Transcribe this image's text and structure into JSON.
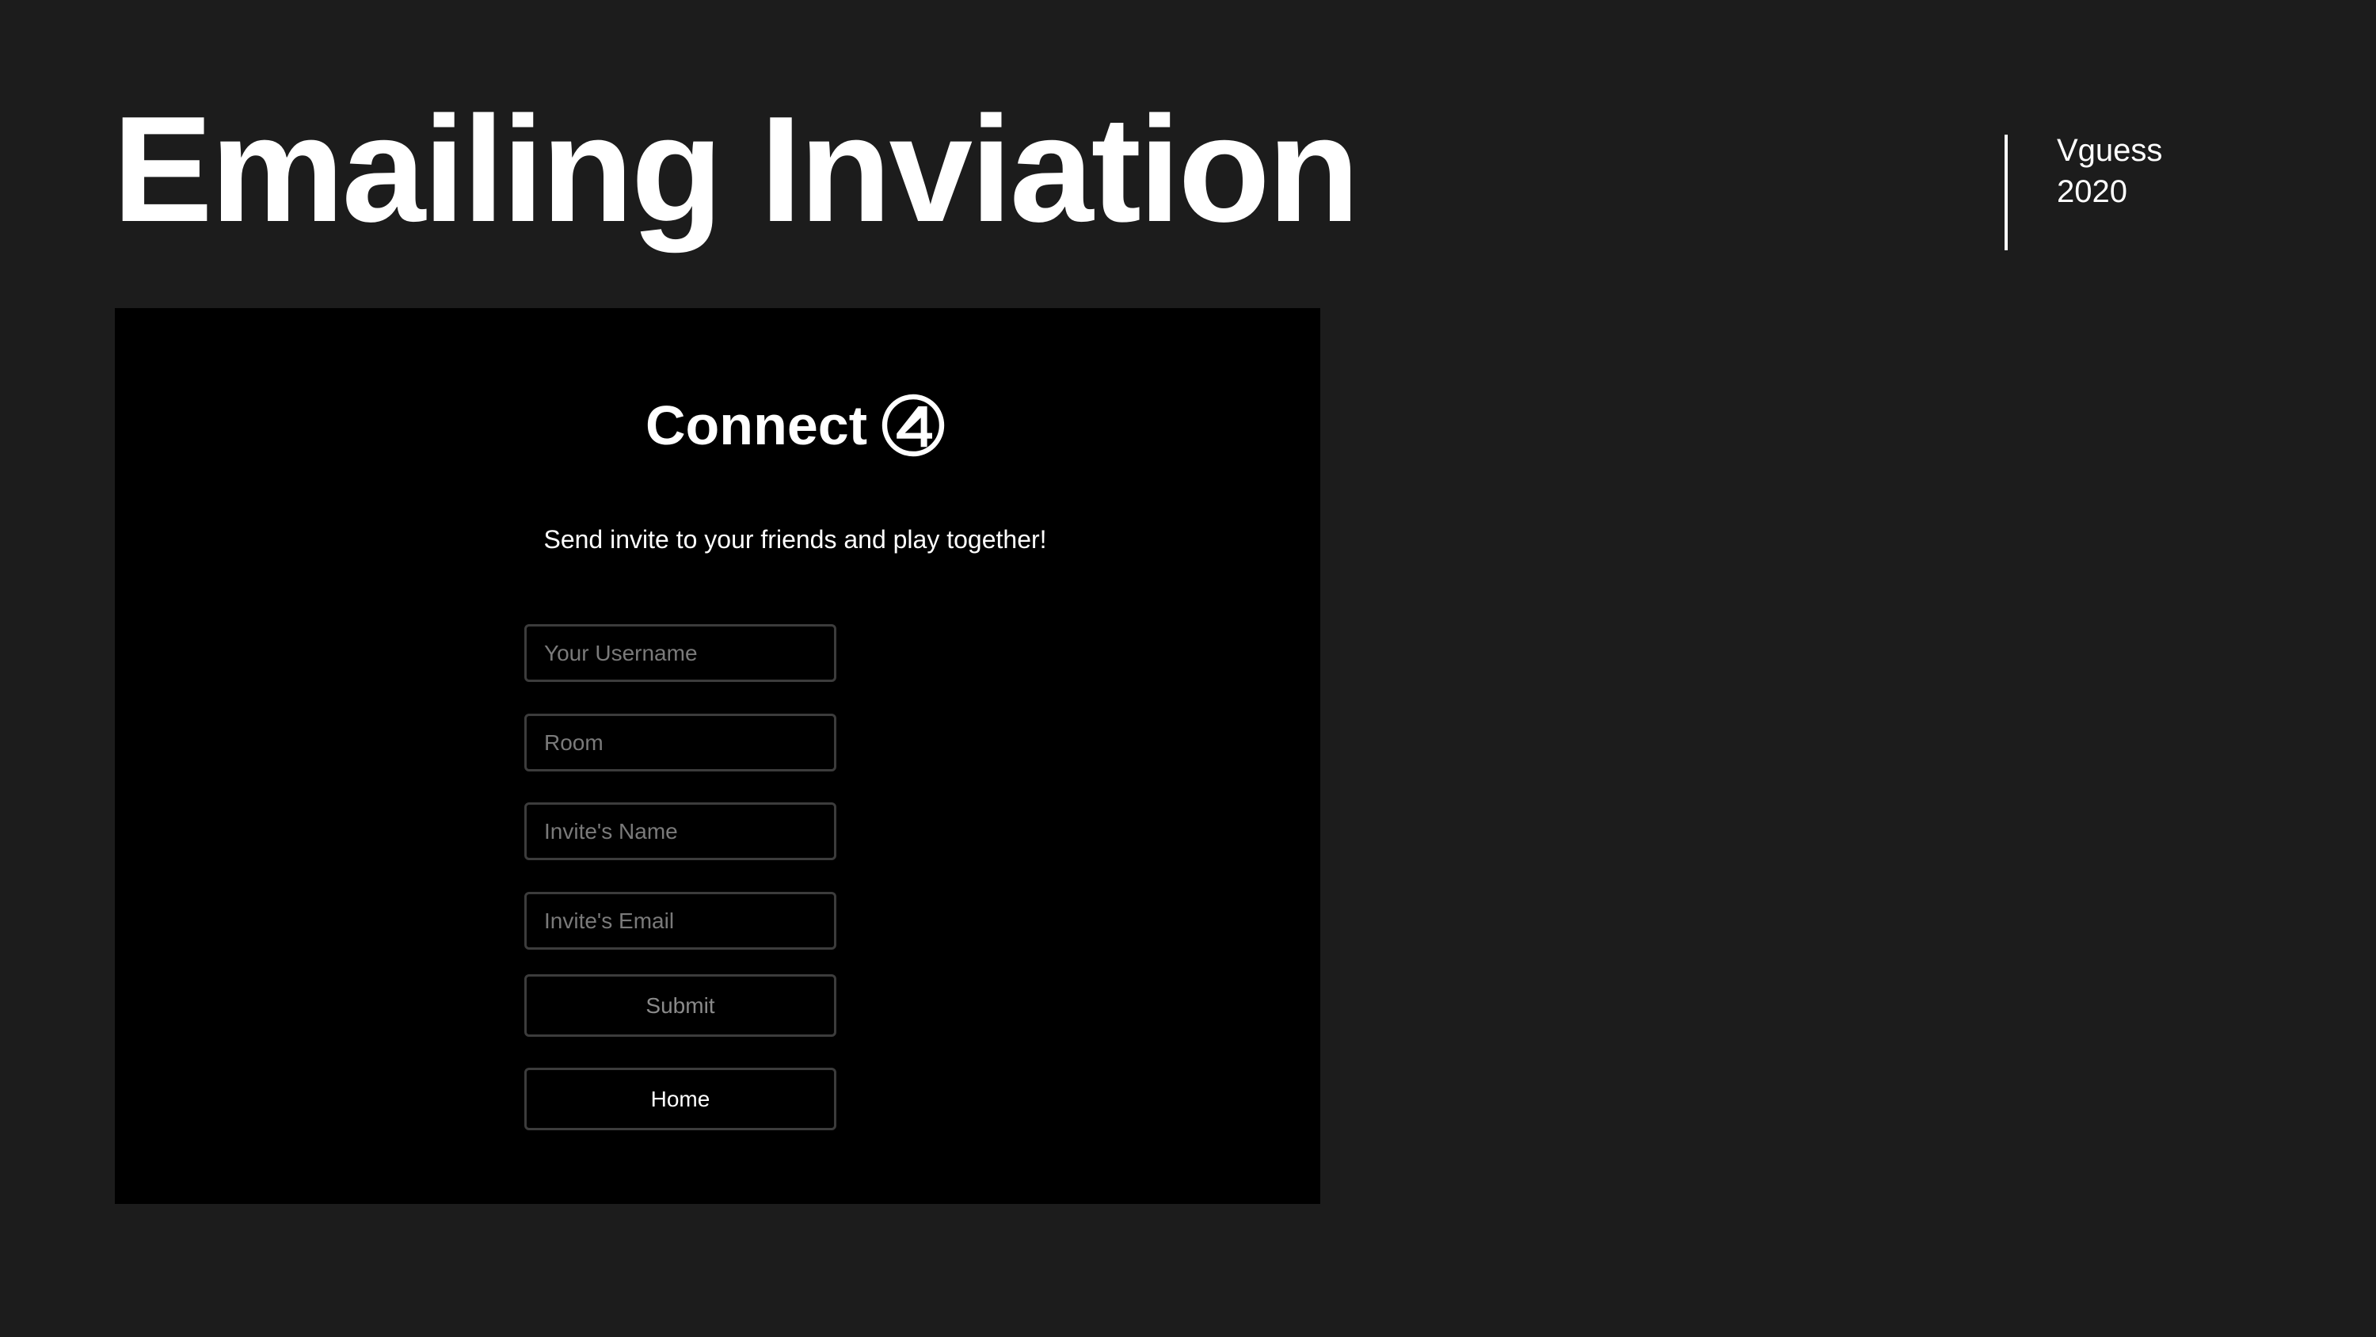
{
  "slide": {
    "title": "Emailing Inviation",
    "author": "Vguess",
    "year": "2020"
  },
  "app": {
    "title": "Connect",
    "title_icon": "circled-four-icon",
    "tagline": "Send invite to your friends and play together!",
    "form": {
      "username_placeholder": "Your Username",
      "room_placeholder": "Room",
      "invite_name_placeholder": "Invite's Name",
      "invite_email_placeholder": "Invite's Email",
      "submit_label": "Submit",
      "home_label": "Home"
    }
  },
  "colors": {
    "slide_background": "#1c1c1c",
    "app_background": "#000000",
    "field_border": "#3c3c3c",
    "placeholder_text": "#7a7a7a",
    "text": "#ffffff"
  }
}
